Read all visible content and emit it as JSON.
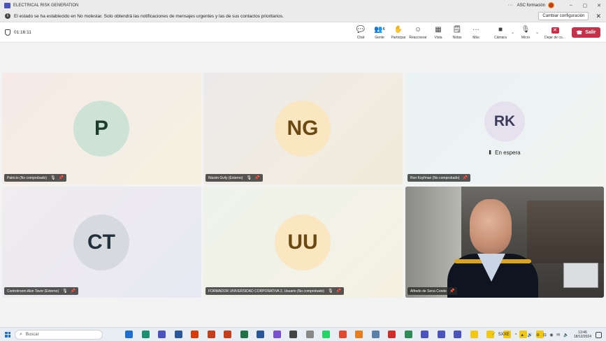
{
  "window": {
    "title": "ELECTRICAL RISK GENERATION",
    "more": "···",
    "org": "ASC formación",
    "minimize": "–",
    "restore": "▢",
    "close": "✕"
  },
  "notification": {
    "info": "i",
    "text": "El estado se ha establecido en No molestar. Solo obtendrá las notificaciones de mensajes urgentes y las de sus contactos prioritarios.",
    "button": "Cambiar configuración",
    "close": "✕"
  },
  "toolbar": {
    "timer": "01:16:11",
    "items": [
      {
        "label": "Chat",
        "icon": "💬"
      },
      {
        "label": "Gente",
        "icon": "👥",
        "badge": "6"
      },
      {
        "label": "Participar",
        "icon": "✋"
      },
      {
        "label": "Reaccionar",
        "icon": "☺"
      },
      {
        "label": "Vista",
        "icon": "▦"
      },
      {
        "label": "Notas",
        "icon": "🗒"
      },
      {
        "label": "Más",
        "icon": "···"
      },
      {
        "label": "Cámara",
        "icon": "■"
      },
      {
        "label": "Micro",
        "icon": "🎙"
      },
      {
        "label": "Dejar de co...",
        "icon": "✕"
      }
    ],
    "chevron": "⌄",
    "leave": "Salir",
    "leave_icon": "☎"
  },
  "participants": [
    {
      "initials": "P",
      "name": "Patricio (No comprobado)",
      "avatar_color": "#cfe2d6",
      "text_color": "#1f3d2c"
    },
    {
      "initials": "NG",
      "name": "Nissim Gvily (Externo)",
      "avatar_color": "#fbe6c2",
      "text_color": "#6b4a12"
    },
    {
      "initials": "RK",
      "name": "Ron Koyfman (No comprobado)",
      "avatar_color": "#e6e1ee",
      "text_color": "#3b3a5a",
      "status": "En espera",
      "status_icon": "II"
    },
    {
      "initials": "CT",
      "name": "Controlroom Alon Tavor (Externo)",
      "avatar_color": "#d6dadf",
      "text_color": "#21303a"
    },
    {
      "initials": "UU",
      "name": "FORMADOR UNIVERSIDAD CORPORATIVA 2, Usuario (No comprobado)",
      "avatar_color": "#fbe6c2",
      "text_color": "#6b4a12"
    },
    {
      "name": "Alfredo de Sena Conde",
      "video": true
    }
  ],
  "glyphs": {
    "mic_off": "🎙",
    "pin": "📌"
  },
  "taskbar": {
    "search": "Buscar",
    "search_icon": "⌕",
    "app_colors": [
      "#1e6fd0",
      "#1b8f6f",
      "#4b53bc",
      "#2b579a",
      "#d83b01",
      "#c43e1c",
      "#c43e1c",
      "#217346",
      "#2b579a",
      "#7a4fd0",
      "#444444",
      "#888888",
      "#25d366",
      "#e04a2f",
      "#e87d1e",
      "#5a7fa8",
      "#d12c2c",
      "#2e8b57",
      "#4b53bc",
      "#4b53bc",
      "#4b53bc",
      "#f2c811",
      "#f2c811",
      "#f2c811",
      "#f2c811",
      "#f2c811"
    ],
    "network": "⟋",
    "network_label": "SXXE",
    "tray_icons": "^ ▲ 🔊 ⊕ ⊟ ◉ ✉ 🔈",
    "time": "13:46",
    "date": "18/12/2024"
  }
}
